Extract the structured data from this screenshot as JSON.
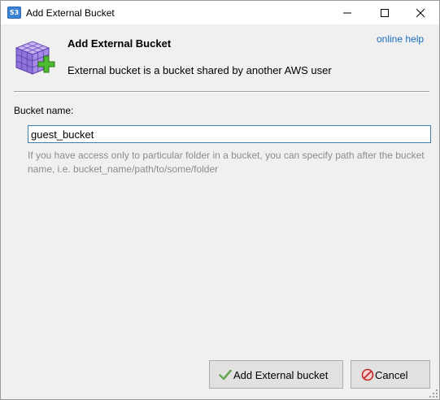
{
  "window": {
    "title": "Add External Bucket",
    "app_icon_text": "S3"
  },
  "header": {
    "title": "Add External Bucket",
    "description": "External bucket is a bucket shared by another  AWS user",
    "help_link": "online help",
    "icon": "cube-add-icon"
  },
  "form": {
    "bucket_label": "Bucket name:",
    "bucket_value": "guest_bucket",
    "hint": "If you have access only to particular folder in a bucket, you can specify path after the bucket name, i.e. bucket_name/path/to/some/folder"
  },
  "buttons": {
    "add_label": "Add External bucket",
    "add_icon": "checkmark-icon",
    "cancel_label": "Cancel",
    "cancel_icon": "cancel-icon"
  },
  "colors": {
    "link": "#1a6fc2",
    "hint_text": "#8c8c8c",
    "input_border": "#3c7fb1"
  }
}
